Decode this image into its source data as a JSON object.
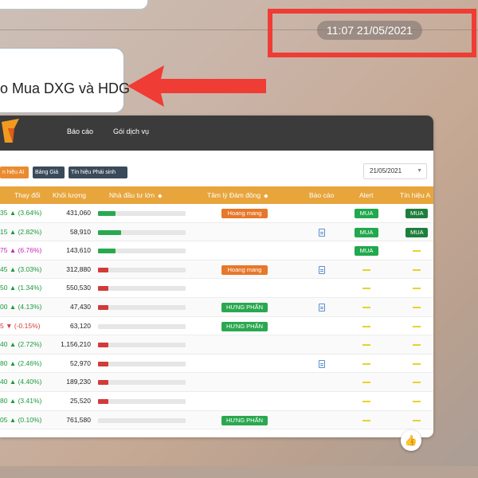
{
  "timestamp": "11:07 21/05/2021",
  "message": "o Mua DXG và HDG",
  "nav": {
    "report": "Báo cáo",
    "service": "Gói dịch vụ"
  },
  "toolbar": {
    "signal_ai": "n hiệu AI",
    "price_board": "Bảng Giá",
    "derivative_signal": "Tín hiệu Phái sinh"
  },
  "date_filter": "21/05/2021",
  "table": {
    "headers": {
      "change": "Thay đổi",
      "volume": "Khối lượng",
      "big_investors": "Nhà đầu tư lớn",
      "sentiment": "Tâm lý Đám đông",
      "report": "Báo cáo",
      "alert": "Alert",
      "signal": "Tín hiệu A"
    },
    "rows": [
      {
        "change": "35 ▲ (3.64%)",
        "dir": "up",
        "volume": "431,060",
        "bar": 0.2,
        "barColor": "#2aa84f",
        "sentiment": "Hoang mang",
        "sentType": "panic",
        "report": false,
        "alert": "MUA",
        "signal": "MUA"
      },
      {
        "change": "15 ▲ (2.82%)",
        "dir": "up",
        "volume": "58,910",
        "bar": 0.26,
        "barColor": "#2aa84f",
        "sentiment": "",
        "sentType": "",
        "report": true,
        "alert": "MUA",
        "signal": "MUA"
      },
      {
        "change": "75 ▲ (6.76%)",
        "dir": "ceil",
        "volume": "143,610",
        "bar": 0.2,
        "barColor": "#2aa84f",
        "sentiment": "",
        "sentType": "",
        "report": false,
        "alert": "MUA",
        "signal": ""
      },
      {
        "change": "45 ▲ (3.03%)",
        "dir": "up",
        "volume": "312,880",
        "bar": 0.12,
        "barColor": "#d33a3a",
        "sentiment": "Hoang mang",
        "sentType": "panic",
        "report": true,
        "alert": "",
        "signal": ""
      },
      {
        "change": "50 ▲ (1.34%)",
        "dir": "up",
        "volume": "550,530",
        "bar": 0.12,
        "barColor": "#d33a3a",
        "sentiment": "",
        "sentType": "",
        "report": false,
        "alert": "",
        "signal": ""
      },
      {
        "change": "00 ▲ (4.13%)",
        "dir": "up",
        "volume": "47,430",
        "bar": 0.12,
        "barColor": "#d33a3a",
        "sentiment": "HƯNG PHẤN",
        "sentType": "eupho",
        "report": true,
        "alert": "",
        "signal": ""
      },
      {
        "change": "5 ▼ (-0.15%)",
        "dir": "down",
        "volume": "63,120",
        "bar": 0.0,
        "barColor": "#d33a3a",
        "sentiment": "HƯNG PHẤN",
        "sentType": "eupho",
        "report": false,
        "alert": "",
        "signal": ""
      },
      {
        "change": "40 ▲ (2.72%)",
        "dir": "up",
        "volume": "1,156,210",
        "bar": 0.12,
        "barColor": "#d33a3a",
        "sentiment": "",
        "sentType": "",
        "report": false,
        "alert": "",
        "signal": ""
      },
      {
        "change": "80 ▲ (2.46%)",
        "dir": "up",
        "volume": "52,970",
        "bar": 0.12,
        "barColor": "#d33a3a",
        "sentiment": "",
        "sentType": "",
        "report": true,
        "alert": "",
        "signal": ""
      },
      {
        "change": "40 ▲ (4.40%)",
        "dir": "up",
        "volume": "189,230",
        "bar": 0.12,
        "barColor": "#d33a3a",
        "sentiment": "",
        "sentType": "",
        "report": false,
        "alert": "",
        "signal": ""
      },
      {
        "change": "80 ▲ (3.41%)",
        "dir": "up",
        "volume": "25,520",
        "bar": 0.12,
        "barColor": "#d33a3a",
        "sentiment": "",
        "sentType": "",
        "report": false,
        "alert": "",
        "signal": ""
      },
      {
        "change": "05 ▲ (0.10%)",
        "dir": "up",
        "volume": "761,580",
        "bar": 0.0,
        "barColor": "#d33a3a",
        "sentiment": "HƯNG PHẤN",
        "sentType": "eupho",
        "report": false,
        "alert": "",
        "signal": ""
      }
    ]
  },
  "colors": {
    "highlight": "#ef3c35",
    "header": "#e7a53c",
    "navbar": "#3b3b3b"
  }
}
